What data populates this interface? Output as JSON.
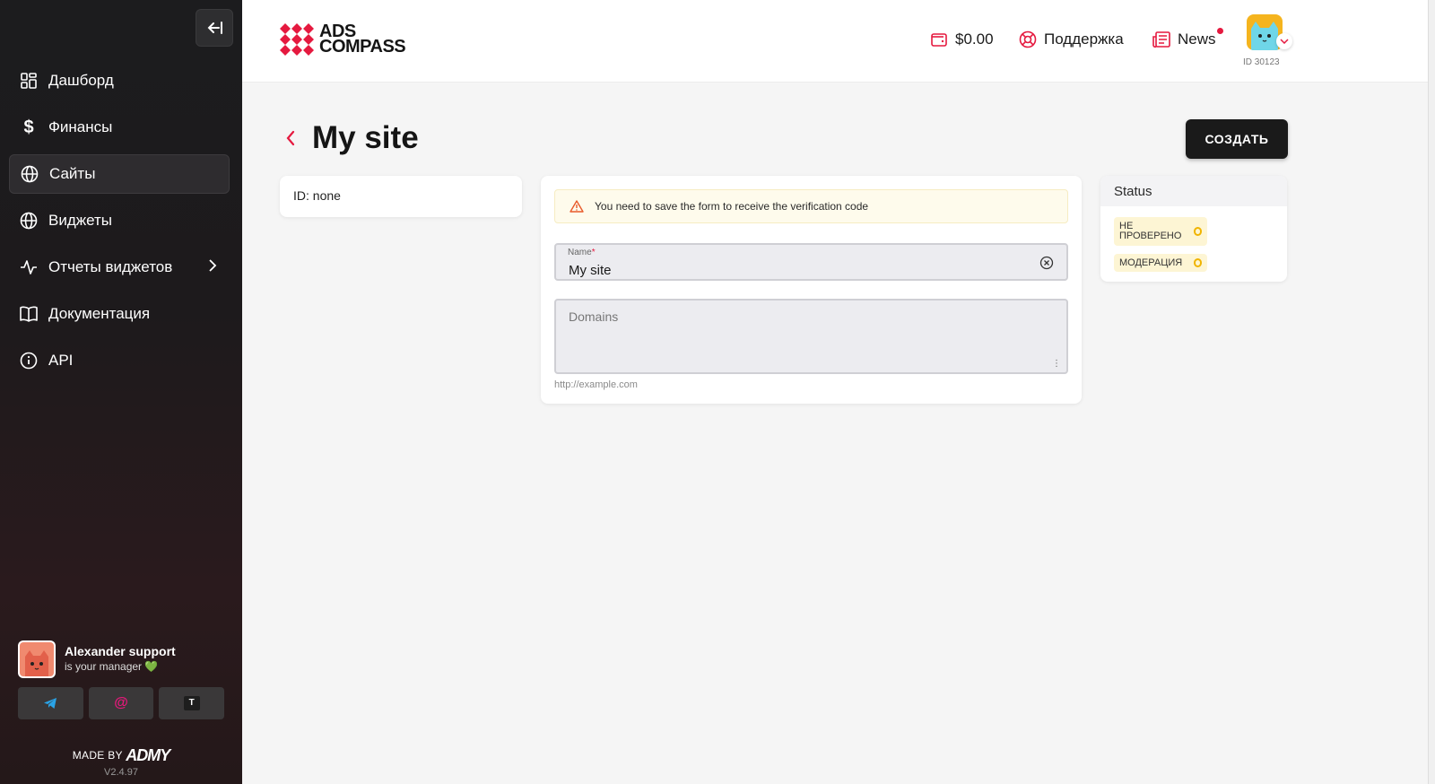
{
  "sidebar": {
    "items": [
      {
        "label": "Дашборд",
        "icon": "dashboard-icon"
      },
      {
        "label": "Финансы",
        "icon": "dollar-icon"
      },
      {
        "label": "Сайты",
        "icon": "globe-icon",
        "active": true
      },
      {
        "label": "Виджеты",
        "icon": "globe-icon"
      },
      {
        "label": "Отчеты виджетов",
        "icon": "pulse-icon"
      },
      {
        "label": "Документация",
        "icon": "book-icon"
      },
      {
        "label": "API",
        "icon": "info-icon"
      }
    ],
    "manager": {
      "name": "Alexander support",
      "subtitle": "is your manager 💚"
    },
    "contacts": [
      "telegram-icon",
      "email-icon",
      "teams-icon"
    ],
    "made_by": "MADE BY",
    "made_by_brand": "ADMY",
    "version": "V2.4.97"
  },
  "header": {
    "logo_line1": "ADS",
    "logo_line2": "COMPASS",
    "balance": "$0.00",
    "support": "Поддержка",
    "news": "News",
    "user_id": "ID 30123"
  },
  "page": {
    "title": "My site",
    "create_button": "СОЗДАТЬ"
  },
  "id_card": {
    "text": "ID: none"
  },
  "form": {
    "warning": "You need to save the form to receive the verification code",
    "name_label": "Name",
    "name_required": "*",
    "name_value": "My site",
    "domains_placeholder": "Domains",
    "domains_hint": "http://example.com"
  },
  "status": {
    "heading": "Status",
    "badges": [
      "НЕ ПРОВЕРЕНО",
      "МОДЕРАЦИЯ"
    ]
  },
  "colors": {
    "accent": "#e5193f",
    "sidebar_bg": "#1c1c1e",
    "badge_bg": "#fdf5d4",
    "badge_icon": "#f0b400"
  }
}
